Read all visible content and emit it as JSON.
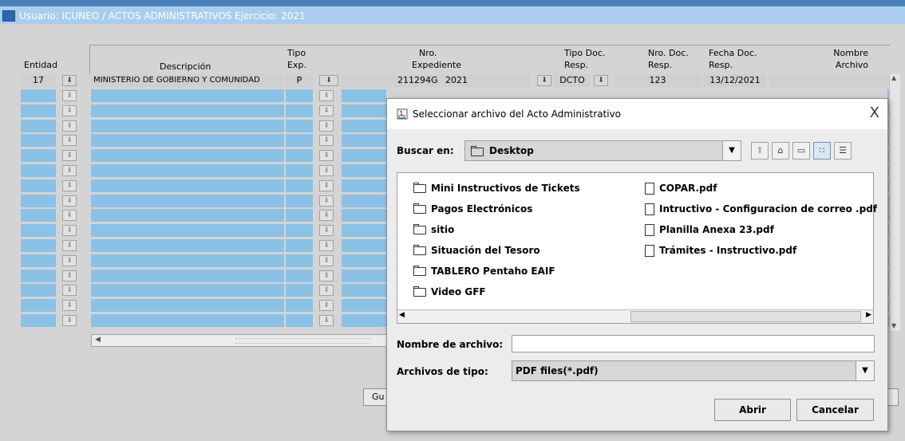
{
  "window": {
    "title": "Usuario: ICUNEO  /  ACTOS ADMINISTRATIVOS  Ejercicio: 2021"
  },
  "grid": {
    "headers": {
      "entidad": "Entidad",
      "descripcion": "Descripción",
      "tipo_exp_1": "Tipo",
      "tipo_exp_2": "Exp.",
      "nro_exp_1": "Nro.",
      "nro_exp_2": "Expediente",
      "tipo_doc_1": "Tipo Doc.",
      "tipo_doc_2": "Resp.",
      "nro_doc_1": "Nro. Doc.",
      "nro_doc_2": "Resp.",
      "fecha_doc_1": "Fecha Doc.",
      "fecha_doc_2": "Resp.",
      "nombre_1": "Nombre",
      "nombre_2": "Archivo"
    },
    "first_row": {
      "entidad": "17",
      "descripcion": "MINISTERIO DE GOBIERNO Y COMUNIDAD",
      "tipo_exp": "P",
      "nro_expediente": "211294G",
      "anio": "2021",
      "tipo_doc": "DCTO",
      "nro_doc": "123",
      "fecha_doc": "13/12/2021",
      "nombre_archivo": ""
    },
    "lov_icon": "download-arrow-icon"
  },
  "background_button": {
    "label_partial": "Gu"
  },
  "dialog": {
    "title": "Seleccionar archivo del Acto Administrativo",
    "look_in_label": "Buscar en:",
    "look_in_value": "Desktop",
    "folders": [
      "Mini Instructivos de Tickets",
      "Pagos Electrónicos",
      "sitio",
      "Situación del Tesoro",
      "TABLERO Pentaho EAIF",
      "Video GFF"
    ],
    "files": [
      "COPAR.pdf",
      "Intructivo - Configuracion de correo .pdf",
      "Planilla Anexa 23.pdf",
      "Trámites - Instructivo.pdf"
    ],
    "file_name_label": "Nombre de archivo:",
    "file_name_value": "",
    "file_type_label": "Archivos de tipo:",
    "file_type_value": "PDF files(*.pdf)",
    "open_button": "Abrir",
    "cancel_button": "Cancelar",
    "close_symbol": "X"
  },
  "colors": {
    "grid_blue": "#8cc1e6",
    "title_blue": "#a9cdee",
    "background": "#d4d4d4"
  }
}
